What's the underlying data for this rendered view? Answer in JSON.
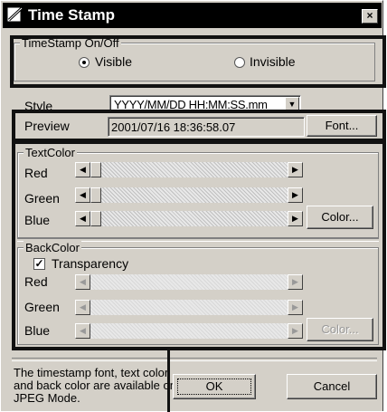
{
  "window": {
    "title": "Time Stamp",
    "close_label": "×"
  },
  "timestamp_group": {
    "label": "TimeStamp On/Off",
    "visible_label": "Visible",
    "invisible_label": "Invisible",
    "selected": "visible"
  },
  "style": {
    "label": "Style",
    "value": "YYYY/MM/DD HH:MM:SS.mm"
  },
  "preview": {
    "label": "Preview",
    "value": "2001/07/16 18:36:58.07",
    "font_button": "Font..."
  },
  "text_color": {
    "label": "TextColor",
    "red_label": "Red",
    "green_label": "Green",
    "blue_label": "Blue",
    "color_button": "Color..."
  },
  "back_color": {
    "label": "BackColor",
    "transparency_label": "Transparency",
    "transparency_checked": true,
    "red_label": "Red",
    "green_label": "Green",
    "blue_label": "Blue",
    "color_button": "Color..."
  },
  "footer": {
    "note_line1": "The timestamp font, text color",
    "note_line2": "and back color are available on",
    "note_line3": "JPEG Mode.",
    "ok_label": "OK",
    "cancel_label": "Cancel"
  }
}
